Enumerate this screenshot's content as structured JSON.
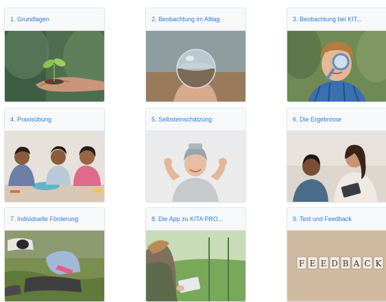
{
  "modules": [
    {
      "label": "1. Grundlagen",
      "image": "sprout-in-hand-photo"
    },
    {
      "label": "2. Beobachtung im Alltag",
      "image": "glass-ball-lens-photo"
    },
    {
      "label": "3. Beobachtung bei KIT...",
      "image": "child-with-magnifier-photo"
    },
    {
      "label": "4. Praxisübung",
      "image": "children-crafting-photo"
    },
    {
      "label": "5. Selbsteinschätzung",
      "image": "boy-flexing-photo"
    },
    {
      "label": "6. Die Ergebnisse",
      "image": "mother-and-child-tablet-photo"
    },
    {
      "label": "7. Individuelle Förderung",
      "image": "children-in-grass-photo"
    },
    {
      "label": "8. Die App zu KITA PRO...",
      "image": "woman-with-tablet-meadow-photo"
    },
    {
      "label": "9. Test und Feedback",
      "image": "feedback-letters-photo"
    }
  ]
}
